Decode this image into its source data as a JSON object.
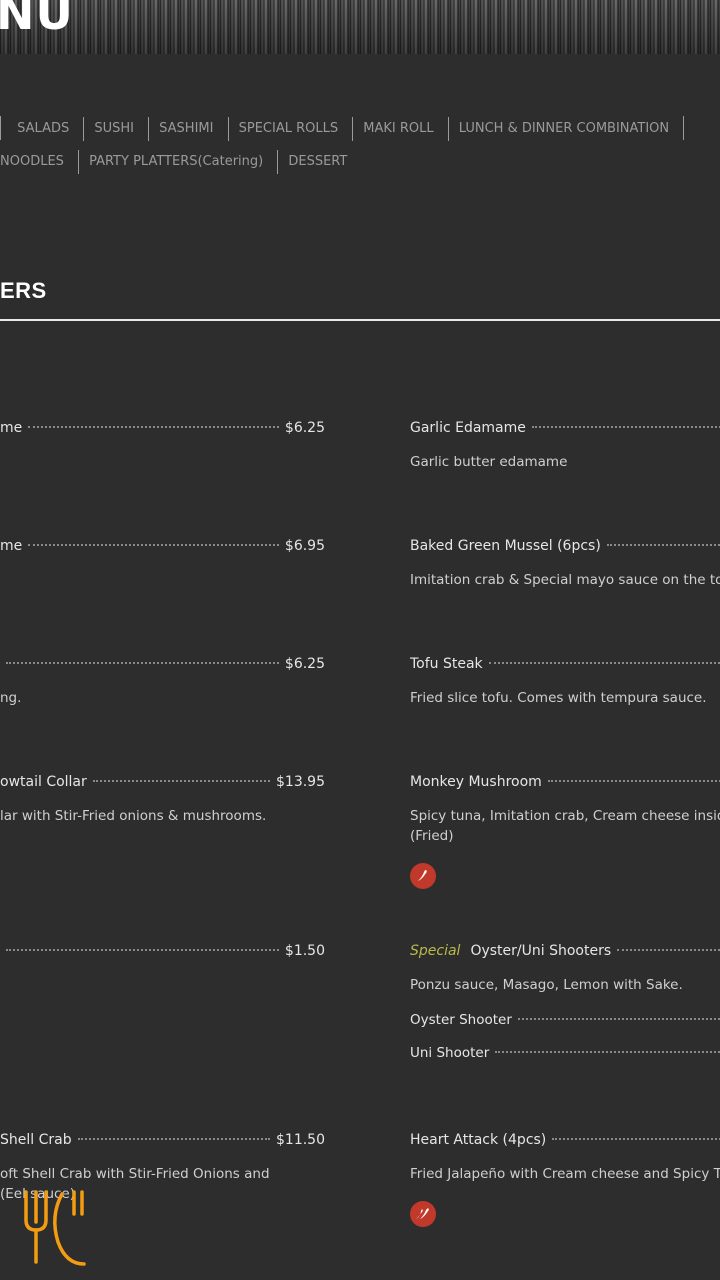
{
  "banner": {
    "title": "NU"
  },
  "nav": {
    "row1": [
      "SALADS",
      "SUSHI",
      "SASHIMI",
      "SPECIAL ROLLS",
      "MAKI ROLL",
      "LUNCH & DINNER COMBINATION"
    ],
    "row2": [
      "NOODLES",
      "PARTY PLATTERS(Catering)",
      "DESSERT"
    ]
  },
  "section": {
    "title": "ERS"
  },
  "left_items": [
    {
      "name": "me",
      "price": "$6.25",
      "desc": ""
    },
    {
      "name": "me",
      "price": "$6.95",
      "desc": ""
    },
    {
      "name": "",
      "price": "$6.25",
      "desc": "ng."
    },
    {
      "name": "owtail Collar",
      "price": "$13.95",
      "desc": "lar with Stir-Fried onions & mushrooms."
    },
    {
      "name": "",
      "price": "$1.50",
      "desc": ""
    },
    {
      "name": "Shell Crab",
      "price": "$11.50",
      "desc_line1": "oft Shell Crab with Stir-Fried Onions and",
      "desc_line2": "(Eel sauce)"
    }
  ],
  "right_items": [
    {
      "name": "Garlic Edamame",
      "desc": "Garlic butter edamame"
    },
    {
      "name": "Baked Green Mussel (6pcs)",
      "desc": "Imitation crab & Special mayo sauce on the top."
    },
    {
      "name": "Tofu Steak",
      "desc": "Fried slice tofu. Comes with tempura sauce."
    },
    {
      "name": "Monkey Mushroom",
      "desc_line1": "Spicy tuna, Imitation crab, Cream cheese inside",
      "desc_line2": "(Fried)"
    },
    {
      "special": "Special",
      "name": "Oyster/Uni Shooters",
      "desc": "Ponzu sauce, Masago, Lemon with Sake.",
      "sub1": "Oyster Shooter",
      "sub2": "Uni Shooter"
    },
    {
      "name": "Heart Attack (4pcs)",
      "desc": "Fried Jalapeño with Cream cheese and Spicy Tur"
    }
  ],
  "icons": {
    "spicy": "chili-icon",
    "logo": "fork-knife-logo-icon"
  },
  "colors": {
    "accent_spicy": "#c0392b",
    "special": "#b9b94a",
    "logo": "#f39c12"
  }
}
